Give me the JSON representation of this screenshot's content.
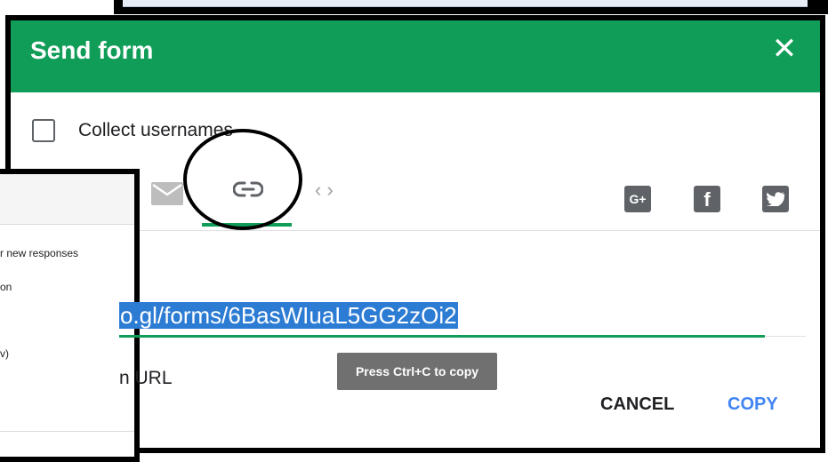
{
  "dialog": {
    "title": "Send form",
    "close_icon": "close-icon"
  },
  "collect_usernames": {
    "label": "Collect usernames",
    "checked": false
  },
  "send_via": {
    "tabs": [
      "email-icon",
      "link-icon",
      "embed-icon"
    ],
    "active": "link-icon",
    "embed_glyph": "‹ ›"
  },
  "social": {
    "gplus_glyph": "G+",
    "facebook_glyph": "f",
    "twitter_glyph": "t"
  },
  "link": {
    "url_visible": "o.gl/forms/6BasWIuaL5GG2zOi2",
    "shorten_label": "n URL"
  },
  "tooltip": {
    "text": "Press Ctrl+C to copy"
  },
  "actions": {
    "cancel": "CANCEL",
    "copy": "COPY"
  },
  "background_panel": {
    "lines": [
      "r new responses",
      "on",
      "v)"
    ]
  },
  "colors": {
    "header": "#0f9d58",
    "accent": "#0f9d58",
    "copy": "#4285f4",
    "tooltip": "#707070",
    "selection": "#2d7cd4"
  }
}
